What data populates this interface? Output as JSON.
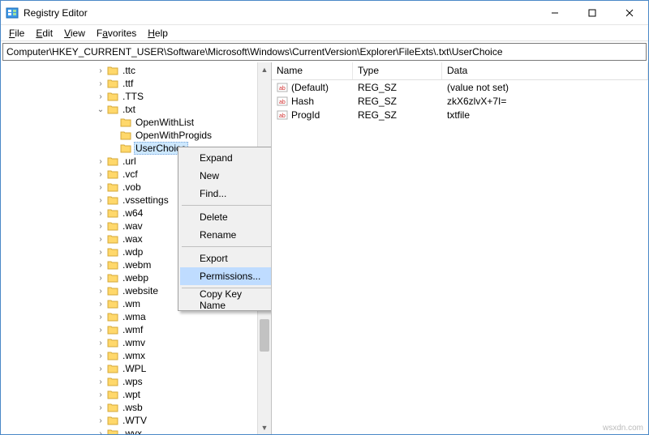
{
  "window": {
    "title": "Registry Editor"
  },
  "menu": {
    "file": "File",
    "edit": "Edit",
    "view": "View",
    "favorites": "Favorites",
    "help": "Help"
  },
  "path": "Computer\\HKEY_CURRENT_USER\\Software\\Microsoft\\Windows\\CurrentVersion\\Explorer\\FileExts\\.txt\\UserChoice",
  "tree_before": [
    {
      "indent": 7,
      "tw": "right",
      "label": ".ttc"
    },
    {
      "indent": 7,
      "tw": "right",
      "label": ".ttf"
    },
    {
      "indent": 7,
      "tw": "right",
      "label": ".TTS"
    },
    {
      "indent": 7,
      "tw": "down",
      "label": ".txt"
    },
    {
      "indent": 8,
      "tw": "none",
      "label": "OpenWithList"
    },
    {
      "indent": 8,
      "tw": "none",
      "label": "OpenWithProgids"
    }
  ],
  "tree_selected": {
    "indent": 8,
    "tw": "none",
    "label": "UserChoice"
  },
  "tree_after": [
    {
      "indent": 7,
      "tw": "right",
      "label": ".url"
    },
    {
      "indent": 7,
      "tw": "right",
      "label": ".vcf"
    },
    {
      "indent": 7,
      "tw": "right",
      "label": ".vob"
    },
    {
      "indent": 7,
      "tw": "right",
      "label": ".vssettings"
    },
    {
      "indent": 7,
      "tw": "right",
      "label": ".w64"
    },
    {
      "indent": 7,
      "tw": "right",
      "label": ".wav"
    },
    {
      "indent": 7,
      "tw": "right",
      "label": ".wax"
    },
    {
      "indent": 7,
      "tw": "right",
      "label": ".wdp"
    },
    {
      "indent": 7,
      "tw": "right",
      "label": ".webm"
    },
    {
      "indent": 7,
      "tw": "right",
      "label": ".webp"
    },
    {
      "indent": 7,
      "tw": "right",
      "label": ".website"
    },
    {
      "indent": 7,
      "tw": "right",
      "label": ".wm"
    },
    {
      "indent": 7,
      "tw": "right",
      "label": ".wma"
    },
    {
      "indent": 7,
      "tw": "right",
      "label": ".wmf"
    },
    {
      "indent": 7,
      "tw": "right",
      "label": ".wmv"
    },
    {
      "indent": 7,
      "tw": "right",
      "label": ".wmx"
    },
    {
      "indent": 7,
      "tw": "right",
      "label": ".WPL"
    },
    {
      "indent": 7,
      "tw": "right",
      "label": ".wps"
    },
    {
      "indent": 7,
      "tw": "right",
      "label": ".wpt"
    },
    {
      "indent": 7,
      "tw": "right",
      "label": ".wsb"
    },
    {
      "indent": 7,
      "tw": "right",
      "label": ".WTV"
    },
    {
      "indent": 7,
      "tw": "right",
      "label": ".wvx"
    }
  ],
  "columns": {
    "name": "Name",
    "type": "Type",
    "data": "Data"
  },
  "values": [
    {
      "name": "(Default)",
      "type": "REG_SZ",
      "data": "(value not set)"
    },
    {
      "name": "Hash",
      "type": "REG_SZ",
      "data": "zkX6zlvX+7I="
    },
    {
      "name": "ProgId",
      "type": "REG_SZ",
      "data": "txtfile"
    }
  ],
  "ctx": {
    "expand": "Expand",
    "new": "New",
    "find": "Find...",
    "delete": "Delete",
    "rename": "Rename",
    "export": "Export",
    "permissions": "Permissions...",
    "copykey": "Copy Key Name"
  },
  "watermark": "wsxdn.com"
}
